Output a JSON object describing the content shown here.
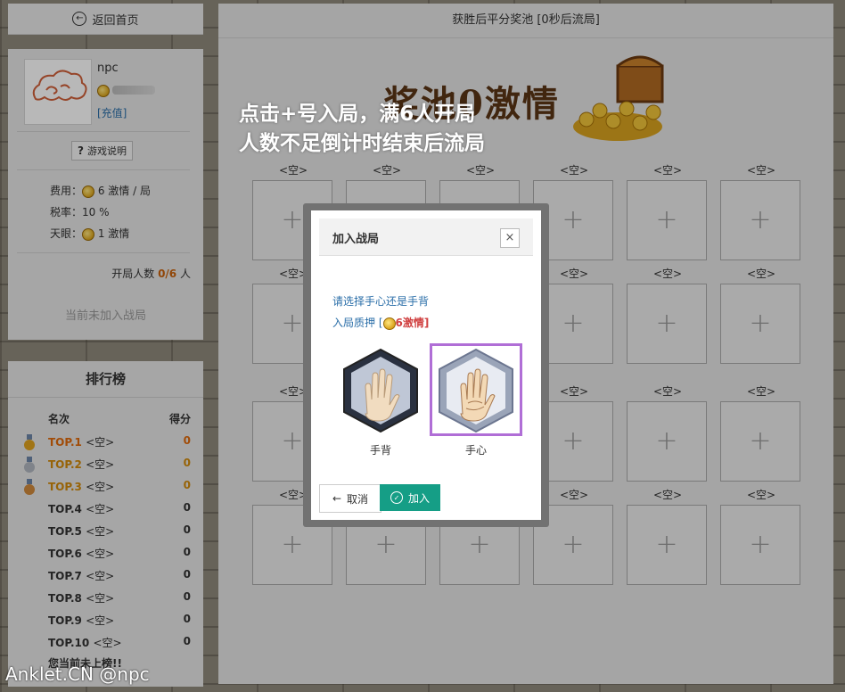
{
  "nav": {
    "back_label": "返回首页"
  },
  "profile": {
    "name": "npc",
    "recharge": "[充值]",
    "help_label": "游戏说明",
    "fee_label": "费用：",
    "fee_value": "6 激情 / 局",
    "tax_label": "税率：",
    "tax_value": "10 %",
    "eye_label": "天眼：",
    "eye_value": "1 激情",
    "players_label": "开局人数",
    "players_count": "0/6",
    "players_unit": "人",
    "status": "当前未加入战局"
  },
  "ranking": {
    "title": "排行榜",
    "col_rank": "名次",
    "col_score": "得分",
    "rows": [
      {
        "rank": "TOP.1",
        "name": "<空>",
        "score": "0",
        "medal": "gold"
      },
      {
        "rank": "TOP.2",
        "name": "<空>",
        "score": "0",
        "medal": "silver"
      },
      {
        "rank": "TOP.3",
        "name": "<空>",
        "score": "0",
        "medal": "bronze"
      },
      {
        "rank": "TOP.4",
        "name": "<空>",
        "score": "0"
      },
      {
        "rank": "TOP.5",
        "name": "<空>",
        "score": "0"
      },
      {
        "rank": "TOP.6",
        "name": "<空>",
        "score": "0"
      },
      {
        "rank": "TOP.7",
        "name": "<空>",
        "score": "0"
      },
      {
        "rank": "TOP.8",
        "name": "<空>",
        "score": "0"
      },
      {
        "rank": "TOP.9",
        "name": "<空>",
        "score": "0"
      },
      {
        "rank": "TOP.10",
        "name": "<空>",
        "score": "0"
      }
    ],
    "footer": "您当前未上榜!!"
  },
  "main": {
    "title": "获胜后平分奖池 [0秒后流局]",
    "pool_title": "奖池0激情",
    "seat_label": "<空>",
    "seat_plus": "+"
  },
  "overlay": {
    "line1": "点击+号入局，满6人开局",
    "line2": "人数不足倒计时结束后流局"
  },
  "modal": {
    "title": "加入战局",
    "close": "×",
    "prompt1": "请选择手心还是手背",
    "prompt2_pre": "入局质押 [",
    "prompt2_amount": "6激情",
    "prompt2_post": "]",
    "option_back": "手背",
    "option_palm": "手心",
    "cancel_label": "取消",
    "join_label": "加入"
  },
  "watermark": "Anklet.CN @npc"
}
